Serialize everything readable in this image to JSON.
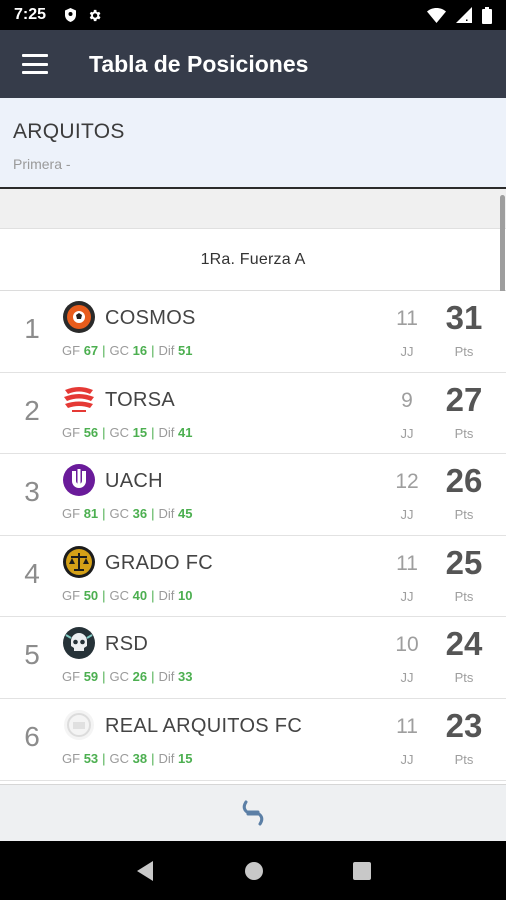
{
  "status_bar": {
    "time": "7:25"
  },
  "app_bar": {
    "title": "Tabla de Posiciones"
  },
  "team": {
    "name": "ARQUITOS",
    "subtitle": "Primera -"
  },
  "division": {
    "title": "1Ra. Fuerza A"
  },
  "labels": {
    "gf": "GF",
    "gc": "GC",
    "dif": "Dif",
    "jj": "JJ",
    "pts": "Pts",
    "sep": "|"
  },
  "standings": [
    {
      "pos": "1",
      "team": "COSMOS",
      "gf": "67",
      "gc": "16",
      "dif": "51",
      "jj": "11",
      "pts": "31",
      "logo": "cosmos-ball-logo"
    },
    {
      "pos": "2",
      "team": "TORSA",
      "gf": "56",
      "gc": "15",
      "dif": "41",
      "jj": "9",
      "pts": "27",
      "logo": "torsa-red-logo"
    },
    {
      "pos": "3",
      "team": "UACH",
      "gf": "81",
      "gc": "36",
      "dif": "45",
      "jj": "12",
      "pts": "26",
      "logo": "uach-purple-logo"
    },
    {
      "pos": "4",
      "team": "GRADO FC",
      "gf": "50",
      "gc": "40",
      "dif": "10",
      "jj": "11",
      "pts": "25",
      "logo": "grado-scales-logo"
    },
    {
      "pos": "5",
      "team": "RSD",
      "gf": "59",
      "gc": "26",
      "dif": "33",
      "jj": "10",
      "pts": "24",
      "logo": "rsd-skull-logo"
    },
    {
      "pos": "6",
      "team": "REAL ARQUITOS FC",
      "gf": "53",
      "gc": "38",
      "dif": "15",
      "jj": "11",
      "pts": "23",
      "logo": "real-arquitos-logo"
    }
  ],
  "colors": {
    "app_bar": "#363c4a",
    "stat_green": "#4caf50",
    "header_bg": "#edf2fa"
  }
}
